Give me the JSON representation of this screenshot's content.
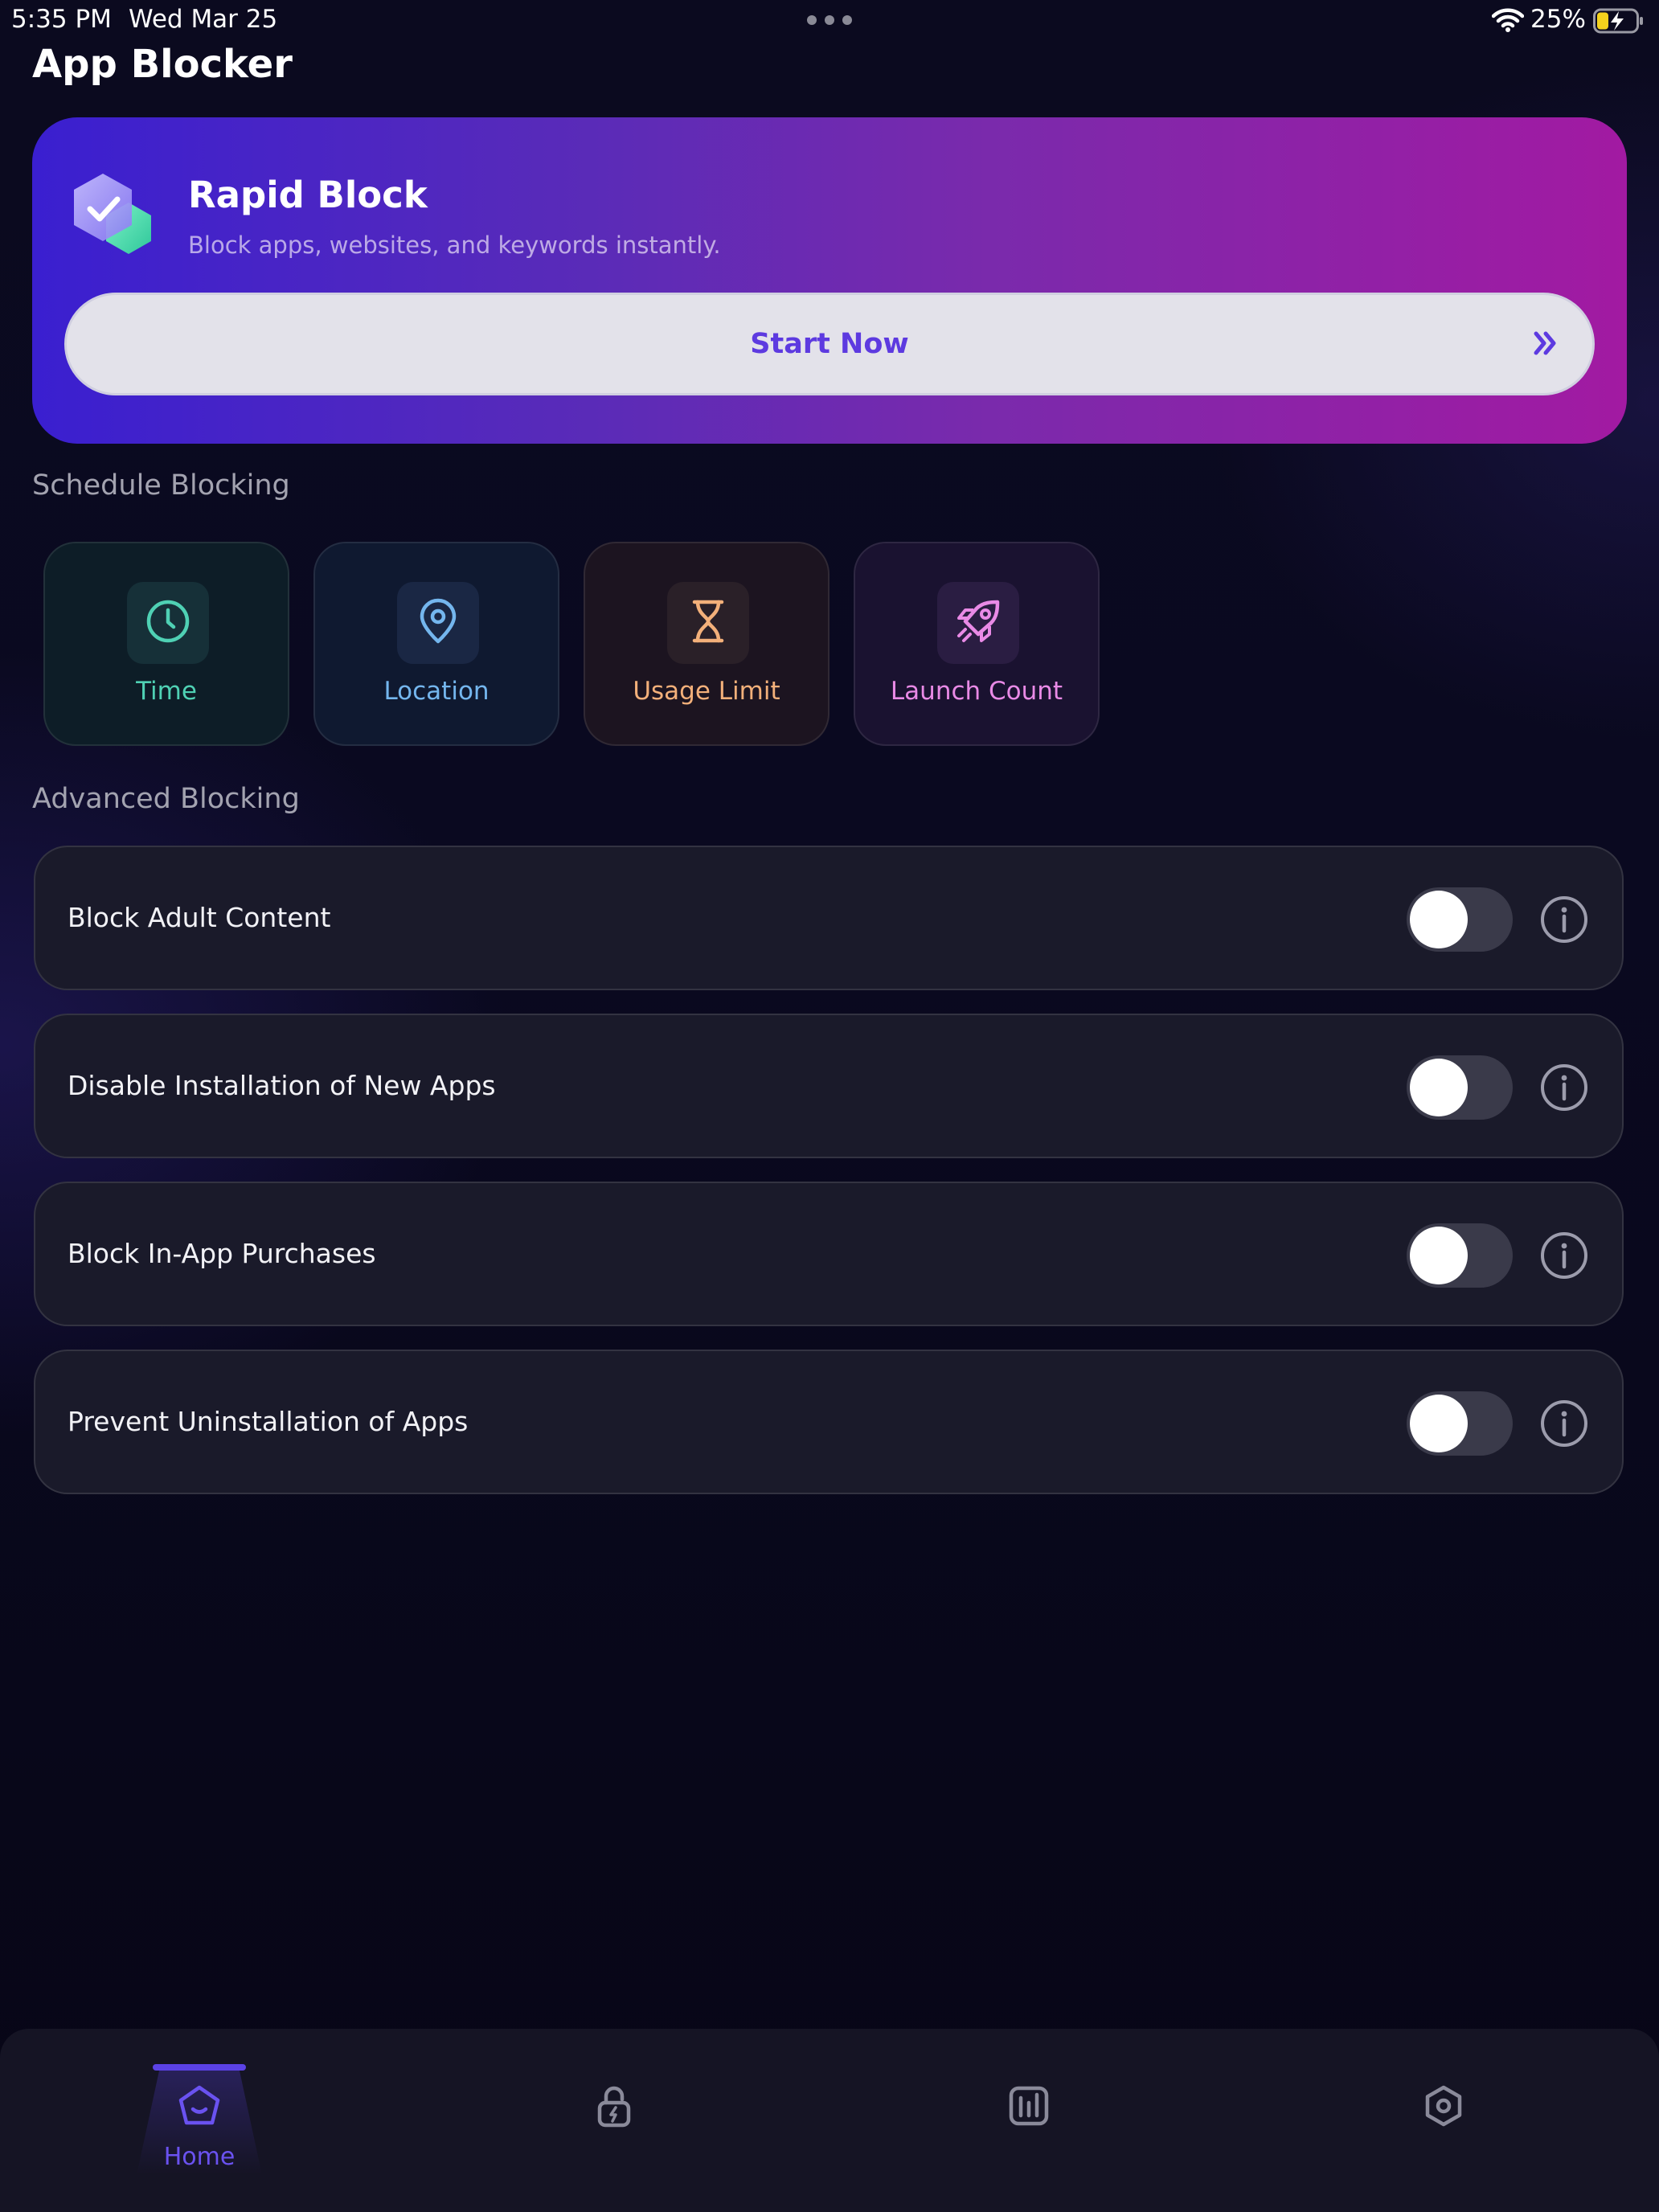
{
  "status_bar": {
    "time": "5:35 PM",
    "date": "Wed Mar 25",
    "battery_percent": "25%",
    "icons": [
      "wifi-icon",
      "battery-charging-icon"
    ]
  },
  "header": {
    "title": "App Blocker"
  },
  "rapid_block": {
    "title": "Rapid Block",
    "subtitle": "Block apps, websites, and keywords instantly.",
    "button_label": "Start Now",
    "icon": "shield-check-icon"
  },
  "schedule": {
    "section_label": "Schedule Blocking",
    "items": [
      {
        "label": "Time",
        "icon": "clock-icon",
        "color": "#4fd1b4"
      },
      {
        "label": "Location",
        "icon": "location-pin-icon",
        "color": "#74b6ee"
      },
      {
        "label": "Usage Limit",
        "icon": "hourglass-icon",
        "color": "#f3b07a"
      },
      {
        "label": "Launch Count",
        "icon": "rocket-icon",
        "color": "#e98ae6"
      }
    ]
  },
  "advanced": {
    "section_label": "Advanced Blocking",
    "items": [
      {
        "label": "Block Adult Content",
        "enabled": false
      },
      {
        "label": "Disable Installation of New Apps",
        "enabled": false
      },
      {
        "label": "Block In-App Purchases",
        "enabled": false
      },
      {
        "label": "Prevent Uninstallation of Apps",
        "enabled": false
      }
    ]
  },
  "tab_bar": {
    "home_label": "Home",
    "active_tab": "Home",
    "accent_color": "#5b42e6",
    "icons": [
      "home-icon",
      "lock-bolt-icon",
      "stats-icon",
      "settings-icon"
    ]
  }
}
